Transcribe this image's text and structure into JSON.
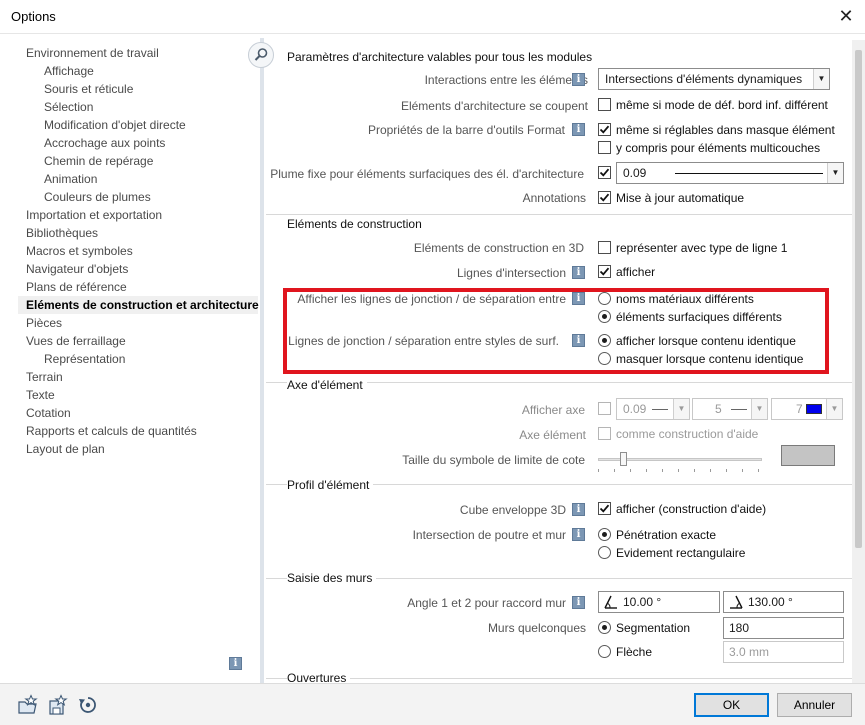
{
  "window": {
    "title": "Options"
  },
  "tree": {
    "items": [
      {
        "label": "Environnement de travail",
        "level": 1
      },
      {
        "label": "Affichage",
        "level": 2
      },
      {
        "label": "Souris et réticule",
        "level": 2
      },
      {
        "label": "Sélection",
        "level": 2
      },
      {
        "label": "Modification d'objet directe",
        "level": 2
      },
      {
        "label": "Accrochage aux points",
        "level": 2
      },
      {
        "label": "Chemin de repérage",
        "level": 2
      },
      {
        "label": "Animation",
        "level": 2
      },
      {
        "label": "Couleurs de plumes",
        "level": 2
      },
      {
        "label": "Importation et exportation",
        "level": 1
      },
      {
        "label": "Bibliothèques",
        "level": 1
      },
      {
        "label": "Macros et symboles",
        "level": 1
      },
      {
        "label": "Navigateur d'objets",
        "level": 1
      },
      {
        "label": "Plans de référence",
        "level": 1
      },
      {
        "label": "Eléments de construction et architecture",
        "level": 1,
        "selected": true
      },
      {
        "label": "Pièces",
        "level": 1
      },
      {
        "label": "Vues de ferraillage",
        "level": 1
      },
      {
        "label": "Représentation",
        "level": 2
      },
      {
        "label": "Terrain",
        "level": 1
      },
      {
        "label": "Texte",
        "level": 1
      },
      {
        "label": "Cotation",
        "level": 1
      },
      {
        "label": "Rapports et calculs de quantités",
        "level": 1
      },
      {
        "label": "Layout de plan",
        "level": 1
      }
    ]
  },
  "sections": {
    "general": {
      "header": "Paramètres d'architecture valables pour tous les modules",
      "interactions_label": "Interactions entre les éléments",
      "interactions_value": "Intersections d'éléments dynamiques",
      "intersect_label": "Eléments d'architecture se coupent",
      "intersect_cb": "même si mode de déf. bord inf. différent",
      "toolbar_label": "Propriétés de la barre d'outils Format",
      "toolbar_cb1": "même si réglables dans masque élément",
      "toolbar_cb2": "y compris pour éléments multicouches",
      "pen_label": "Plume fixe pour éléments surfaciques des él. d'architecture",
      "pen_value": "0.09",
      "annot_label": "Annotations",
      "annot_cb": "Mise à jour automatique"
    },
    "construction": {
      "header": "Eléments de construction",
      "el3d_label": "Eléments de construction en 3D",
      "el3d_cb": "représenter avec type de ligne 1",
      "lines_label": "Lignes d'intersection",
      "lines_cb": "afficher",
      "join_label": "Afficher les lignes de jonction / de séparation entre",
      "join_opt1": "noms matériaux différents",
      "join_opt2": "éléments surfaciques différents",
      "styles_label": "Lignes de jonction / séparation entre styles de surf.",
      "styles_opt1": "afficher lorsque contenu identique",
      "styles_opt2": "masquer lorsque contenu identique"
    },
    "axis": {
      "header": "Axe d'élément",
      "show_label": "Afficher axe",
      "pen": "0.09",
      "line": "5",
      "color": "7",
      "color_hex": "#0000ee",
      "axe_label": "Axe élément",
      "axe_cb": "comme construction d'aide",
      "size_label": "Taille du symbole de limite de cote",
      "swatch_hex": "#c4c4c4"
    },
    "profile": {
      "header": "Profil d'élément",
      "cube_label": "Cube enveloppe 3D",
      "cube_cb": "afficher (construction d'aide)",
      "beam_label": "Intersection de poutre et mur",
      "beam_opt1": "Pénétration exacte",
      "beam_opt2": "Evidement rectangulaire"
    },
    "walls": {
      "header": "Saisie des murs",
      "angle_label": "Angle 1 et 2 pour raccord mur",
      "angle1": "10.00 °",
      "angle2": "130.00 °",
      "any_label": "Murs quelconques",
      "seg_label": "Segmentation",
      "seg_value": "180",
      "arrow_label": "Flèche",
      "arrow_value": "3.0 mm"
    },
    "openings": {
      "header": "Ouvertures"
    }
  },
  "buttons": {
    "ok": "OK",
    "cancel": "Annuler"
  },
  "icons": {
    "info": "i",
    "close": "✕"
  }
}
